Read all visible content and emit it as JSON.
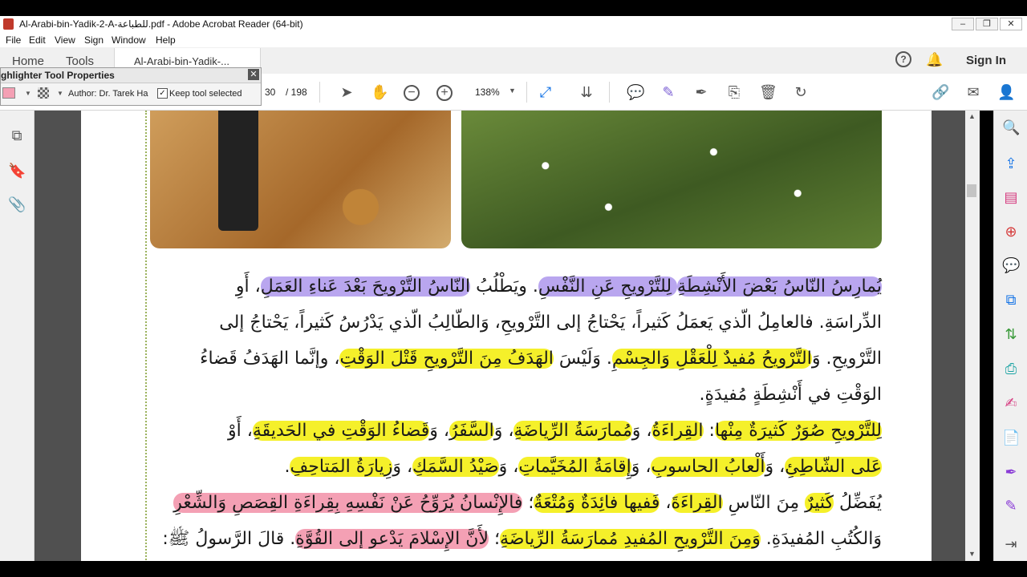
{
  "window": {
    "title": "Al-Arabi-bin-Yadik-2-A-للطباعة.pdf - Adobe Acrobat Reader (64-bit)",
    "min": "–",
    "max": "❐",
    "close": "✕"
  },
  "menu": [
    "File",
    "Edit",
    "View",
    "Sign",
    "Window",
    "Help"
  ],
  "tabs": {
    "home": "Home",
    "tools": "Tools",
    "document": "Al-Arabi-bin-Yadik-...",
    "sign_in": "Sign In"
  },
  "toolbar": {
    "page_current": "30",
    "page_total": "/  198",
    "zoom": "138%"
  },
  "highlighter_panel": {
    "title": "ghlighter Tool Properties",
    "author": "Author: Dr. Tarek Ha",
    "keep_tool": "Keep tool selected",
    "keep_checked": true,
    "color": "#f4a0b4"
  },
  "document_text": [
    [
      "يُمارِسُ النّاسُ بَعْضَ الأَنْشِطَةِ",
      " لِلتَّرْويحِ عَنِ النَّفْسِ",
      ". ويَطْلُبُ ",
      "النّاسُ التَّرْويحَ بَعْدَ عَناءِ العَمَلِ",
      "، أَوِ"
    ],
    [
      "الدِّراسَةِ. فالعامِلُ الّذي يَعمَلُ كَثيراً، يَحْتاجُ إلى التَّرْويحِ، وَالطّالِبُ الّذي يَدْرُسُ كَثيراً، يَحْتاجُ إلى"
    ],
    [
      "التَّرْويحِ. وَ",
      "التَّرْويحُ مُفيدٌ لِلْعَقْلِ وَالجِسْمِ",
      ". وَلَيْسَ ",
      "الهَدَفُ مِنَ التَّرْويحِ قَتْلَ الوَقْتِ",
      "، وإنَّما الهَدَفُ قَضاءُ"
    ],
    [
      "الوَقْتِ في أَنْشِطَةٍ مُفيدَةٍ."
    ],
    [
      "لِلتَّرْويحِ صُوَرٌ كَثيرَةٌ مِنْها",
      ": ",
      "القِراءَةُ",
      "، وَ",
      "مُمارَسَةُ الرِّياضَةِ",
      "، وَ",
      "السَّفَرُ",
      "، وَ",
      "قَضاءُ الوَقْتِ في الحَديقَةِ",
      "، أَوْ"
    ],
    [
      "عَلى الشّاطِئِ",
      "، وَ",
      "أَلْعابُ الحاسوبِ",
      "، وَ",
      "إِقامَةُ المُخَيَّماتِ",
      "، وَ",
      "صَيْدُ السَّمَكِ",
      "، وَ",
      "زِيارَةُ المَتاحِفِ",
      "."
    ],
    [
      "يُفَضِّلُ ",
      "كَثيرٌ",
      " مِنَ النّاسِ ",
      "القِراءَةَ",
      "، ",
      "فَفيها فائِدَةٌ وَمُتْعَةٌ",
      "؛ ",
      "فالإِنْسانُ يُرَوِّحُ عَنْ نَفْسِهِ بِقِراءَةِ القِصَصِ وَالشِّعْرِ"
    ],
    [
      "وَالكُتُبِ المُفيدَةِ. ",
      "وَمِنَ التَّرْويحِ المُفيدِ مُمارَسَةُ الرِّياضَةِ",
      "؛ ",
      "لأَنَّ الإِسْلامَ يَدْعو إلى القُوَّةِ",
      ". قالَ الرَّسولُ ﷺ:"
    ]
  ],
  "highlight_classes": [
    [
      "hl-p",
      "hl-p",
      "",
      "hl-p",
      ""
    ],
    [
      ""
    ],
    [
      "",
      "hl-y",
      "",
      "hl-y",
      ""
    ],
    [
      ""
    ],
    [
      "hl-y",
      "",
      "hl-y",
      "",
      "hl-y",
      "",
      "hl-y",
      "",
      "hl-y",
      ""
    ],
    [
      "hl-y",
      "",
      "hl-y",
      "",
      "hl-y",
      "",
      "hl-y",
      "",
      "hl-y",
      ""
    ],
    [
      "",
      "hl-y",
      "",
      "hl-y",
      "",
      "hl-y",
      "",
      "hl-k"
    ],
    [
      "",
      "hl-y",
      "",
      "hl-k",
      ""
    ]
  ],
  "colors": {
    "purple_highlight": "#b9a6ef",
    "yellow_highlight": "#f5f02a",
    "pink_highlight": "#f4a0b4",
    "accent": "#1473e6"
  }
}
